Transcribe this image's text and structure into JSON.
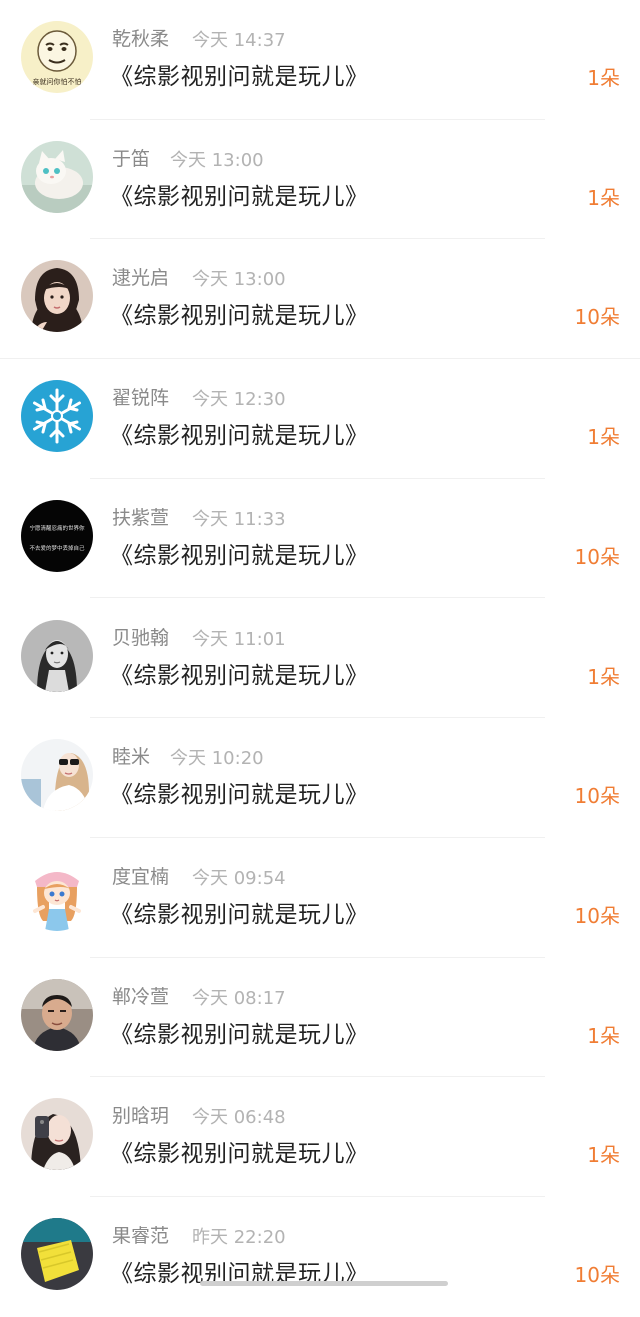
{
  "colors": {
    "name": "#8a8a8a",
    "time": "#b3b3b3",
    "title": "#222222",
    "amount": "#f07d34",
    "divider": "#f0f0f0"
  },
  "items": [
    {
      "name": "乾秋柔",
      "time": "今天 14:37",
      "title": "《综影视别问就是玩儿》",
      "amount": "1朵",
      "avatar": "meme-face-avatar",
      "avatar_caption": "亲就问你怕不怕"
    },
    {
      "name": "于笛",
      "time": "今天 13:00",
      "title": "《综影视别问就是玩儿》",
      "amount": "1朵",
      "avatar": "white-cat-avatar"
    },
    {
      "name": "逮光启",
      "time": "今天 13:00",
      "title": "《综影视别问就是玩儿》",
      "amount": "10朵",
      "avatar": "girl-portrait-avatar"
    },
    {
      "name": "翟锐阵",
      "time": "今天 12:30",
      "title": "《综影视别问就是玩儿》",
      "amount": "1朵",
      "avatar": "snowflake-avatar"
    },
    {
      "name": "扶紫萱",
      "time": "今天 11:33",
      "title": "《综影视别问就是玩儿》",
      "amount": "10朵",
      "avatar": "black-text-avatar",
      "avatar_caption_1": "宁愿清醒忍痛的世界你",
      "avatar_caption_2": "不去爱的梦中丢掉自己"
    },
    {
      "name": "贝驰翰",
      "time": "今天 11:01",
      "title": "《综影视别问就是玩儿》",
      "amount": "1朵",
      "avatar": "bw-girl-avatar"
    },
    {
      "name": "睦米",
      "time": "今天 10:20",
      "title": "《综影视别问就是玩儿》",
      "amount": "10朵",
      "avatar": "sunglasses-girl-avatar"
    },
    {
      "name": "度宜楠",
      "time": "今天 09:54",
      "title": "《综影视别问就是玩儿》",
      "amount": "10朵",
      "avatar": "anime-girl-avatar"
    },
    {
      "name": "郸冷萱",
      "time": "今天 08:17",
      "title": "《综影视别问就是玩儿》",
      "amount": "1朵",
      "avatar": "man-portrait-avatar"
    },
    {
      "name": "别晗玥",
      "time": "今天 06:48",
      "title": "《综影视别问就是玩儿》",
      "amount": "1朵",
      "avatar": "selfie-girl-avatar"
    },
    {
      "name": "果睿范",
      "time": "昨天 22:20",
      "title": "《综影视别问就是玩儿》",
      "amount": "10朵",
      "avatar": "yellow-object-avatar"
    }
  ]
}
